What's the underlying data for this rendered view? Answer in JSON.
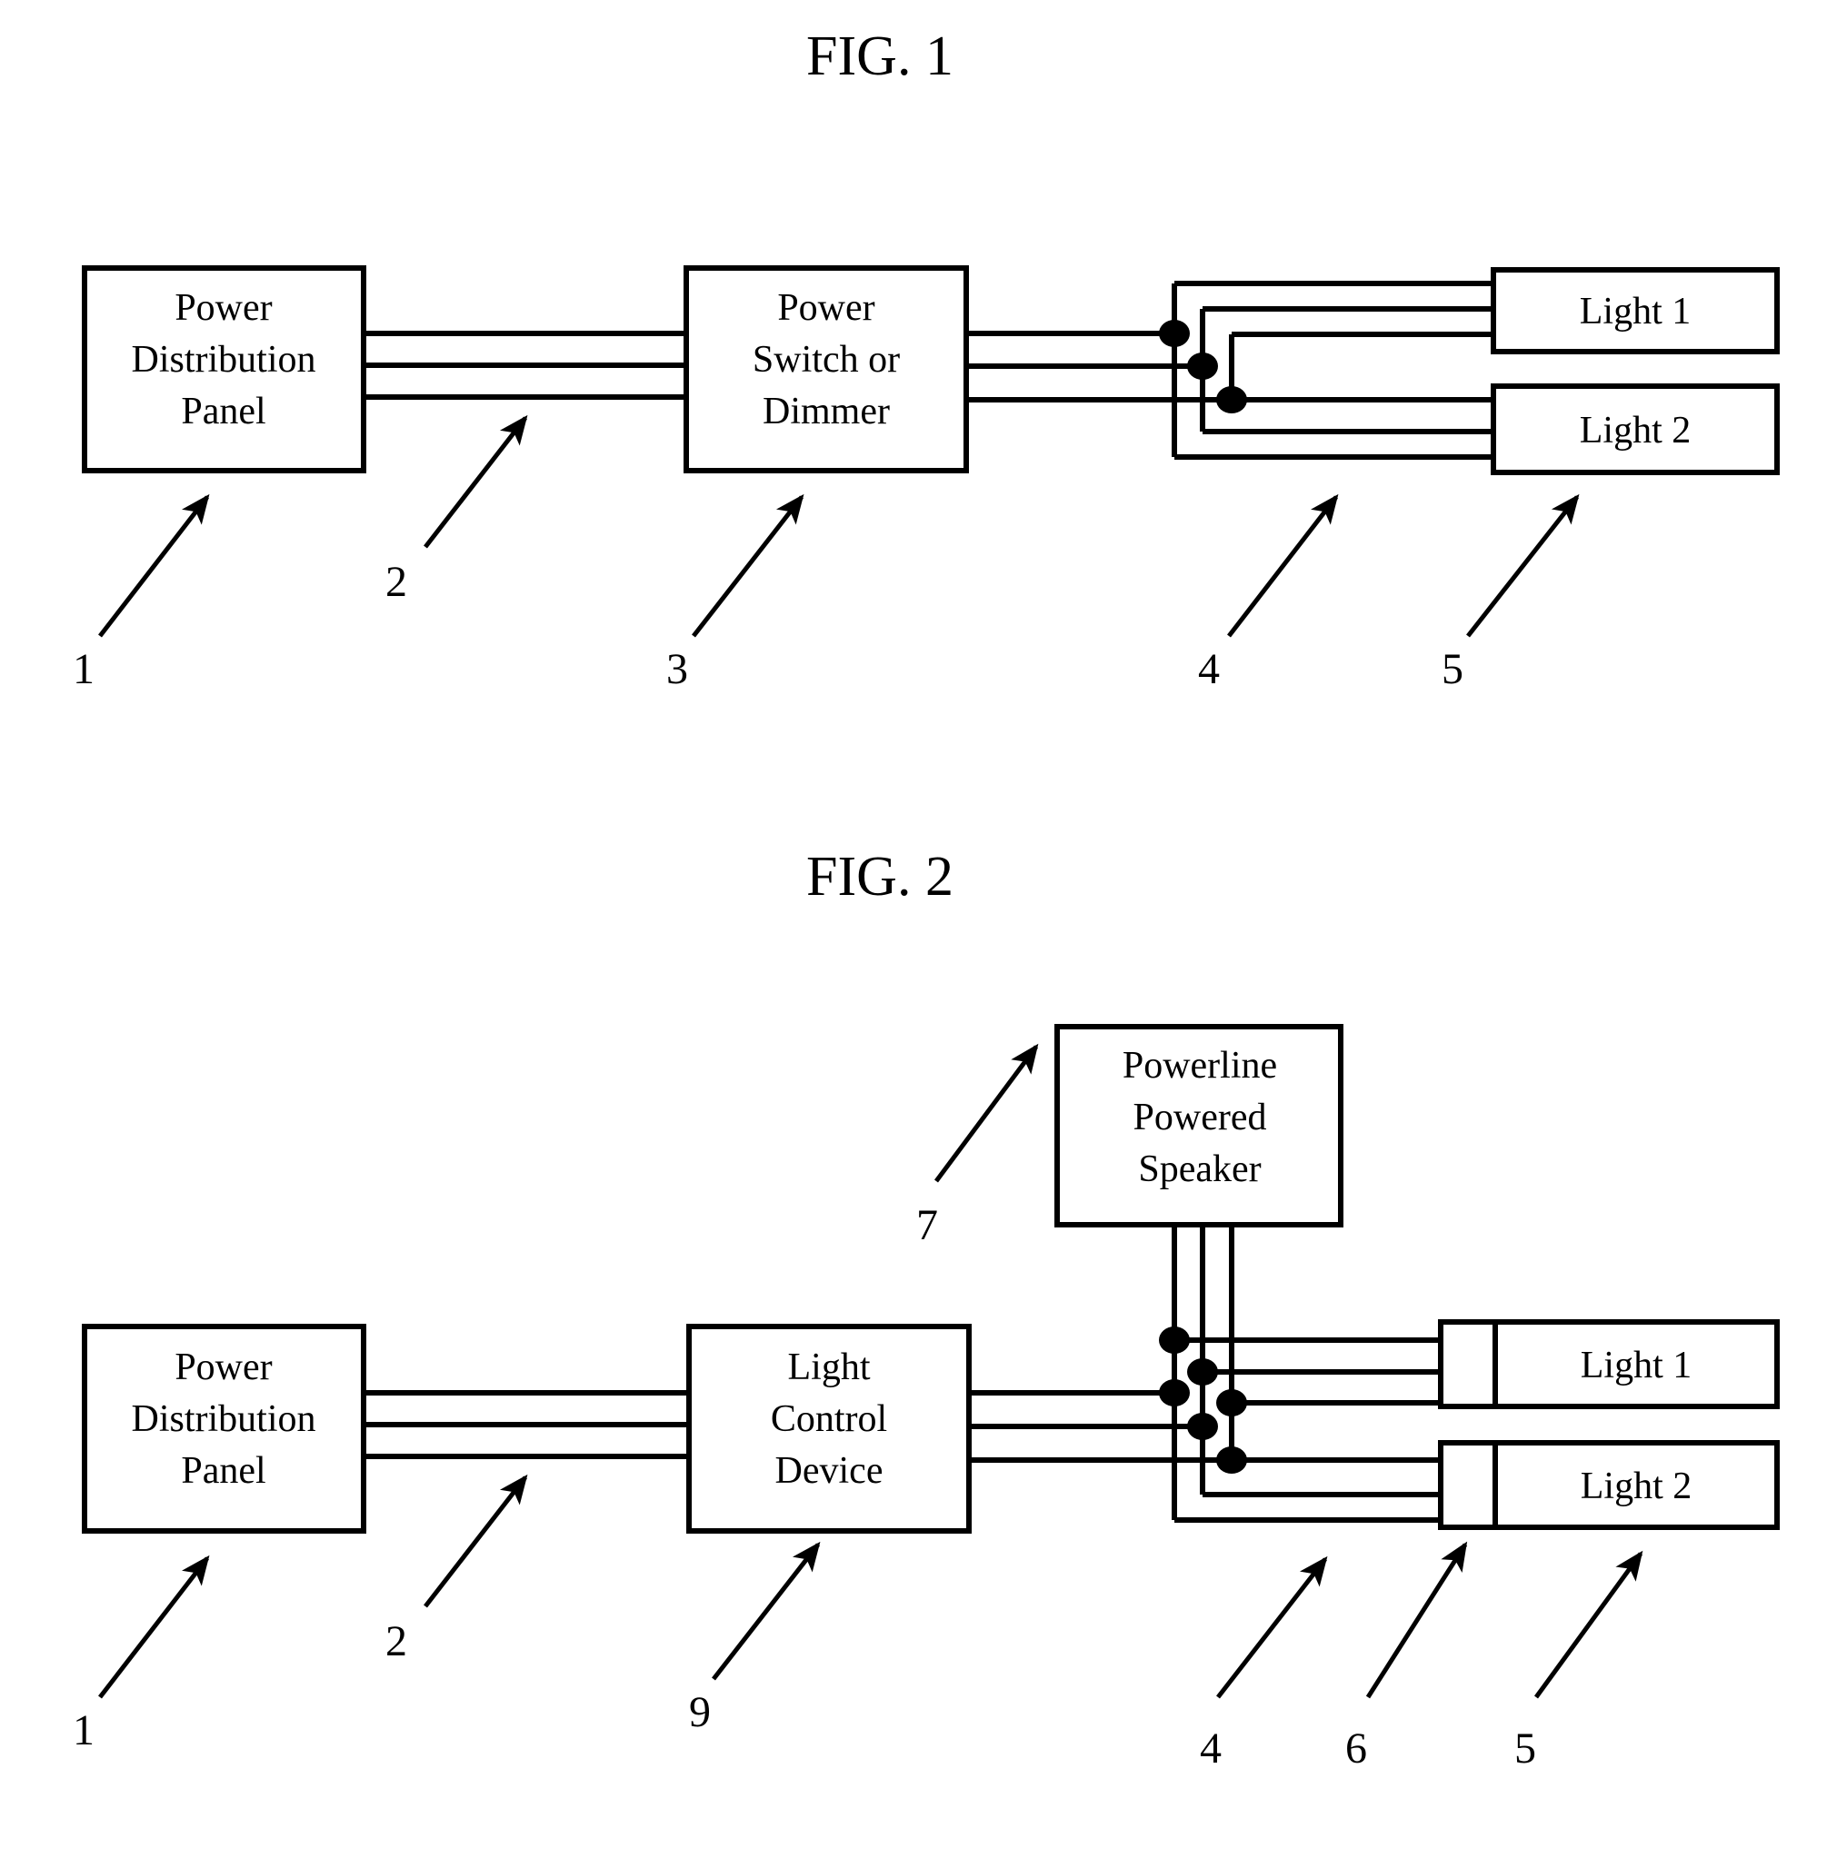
{
  "document": {
    "kind": "patent-drawing-sheet",
    "background_color": "#ffffff",
    "ink_color": "#000000"
  },
  "figures": [
    {
      "id": "fig1",
      "title": "FIG. 1",
      "blocks": [
        {
          "id": "fig1-power-distribution-panel",
          "lines": [
            "Power",
            "Distribution",
            "Panel"
          ]
        },
        {
          "id": "fig1-power-switch-or-dimmer",
          "lines": [
            "Power",
            "Switch or",
            "Dimmer"
          ]
        },
        {
          "id": "fig1-light-1",
          "lines": [
            "Light 1"
          ]
        },
        {
          "id": "fig1-light-2",
          "lines": [
            "Light 2"
          ]
        }
      ],
      "reference_numerals": [
        {
          "id": "fig1-ref-1",
          "label": "1",
          "points_to": "fig1-power-distribution-panel"
        },
        {
          "id": "fig1-ref-2",
          "label": "2",
          "points_to": "fig1-wiring-between-panel-and-switch"
        },
        {
          "id": "fig1-ref-3",
          "label": "3",
          "points_to": "fig1-power-switch-or-dimmer"
        },
        {
          "id": "fig1-ref-4",
          "label": "4",
          "points_to": "fig1-wiring-junction"
        },
        {
          "id": "fig1-ref-5",
          "label": "5",
          "points_to": "fig1-light-2"
        }
      ]
    },
    {
      "id": "fig2",
      "title": "FIG. 2",
      "blocks": [
        {
          "id": "fig2-powerline-powered-speaker",
          "lines": [
            "Powerline",
            "Powered",
            "Speaker"
          ]
        },
        {
          "id": "fig2-power-distribution-panel",
          "lines": [
            "Power",
            "Distribution",
            "Panel"
          ]
        },
        {
          "id": "fig2-light-control-device",
          "lines": [
            "Light",
            "Control",
            "Device"
          ]
        },
        {
          "id": "fig2-light-1",
          "lines": [
            "Light 1"
          ]
        },
        {
          "id": "fig2-light-2",
          "lines": [
            "Light 2"
          ]
        },
        {
          "id": "fig2-connector-1",
          "lines": []
        },
        {
          "id": "fig2-connector-2",
          "lines": []
        }
      ],
      "reference_numerals": [
        {
          "id": "fig2-ref-7",
          "label": "7",
          "points_to": "fig2-powerline-powered-speaker"
        },
        {
          "id": "fig2-ref-1",
          "label": "1",
          "points_to": "fig2-power-distribution-panel"
        },
        {
          "id": "fig2-ref-2",
          "label": "2",
          "points_to": "fig2-wiring-between-panel-and-control"
        },
        {
          "id": "fig2-ref-9",
          "label": "9",
          "points_to": "fig2-light-control-device"
        },
        {
          "id": "fig2-ref-4",
          "label": "4",
          "points_to": "fig2-wiring-junction"
        },
        {
          "id": "fig2-ref-6",
          "label": "6",
          "points_to": "fig2-connector-2"
        },
        {
          "id": "fig2-ref-5",
          "label": "5",
          "points_to": "fig2-light-2"
        }
      ]
    }
  ]
}
